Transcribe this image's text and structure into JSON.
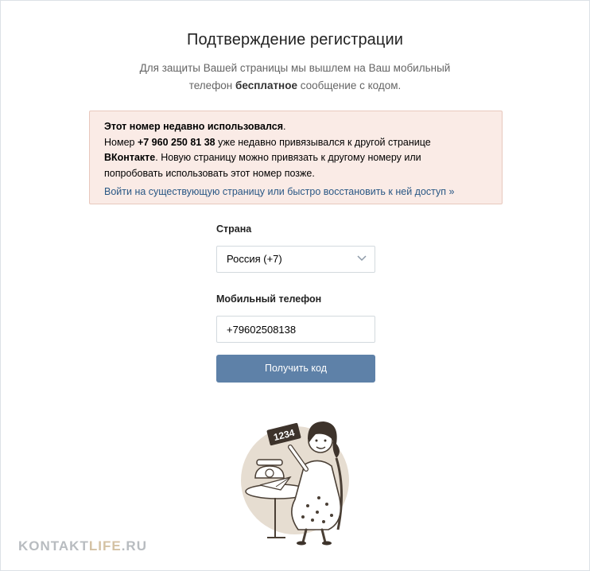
{
  "page": {
    "title": "Подтверждение регистрации",
    "subtitle_line1": "Для защиты Вашей страницы мы вышлем на Ваш мобильный",
    "subtitle_line2_pre": "телефон ",
    "subtitle_line2_bold": "бесплатное",
    "subtitle_line2_post": " сообщение с кодом."
  },
  "alert": {
    "heading": "Этот номер недавно использовался",
    "heading_dot": ".",
    "line1_pre": "Номер ",
    "number": "+7 960 250 81 38",
    "line1_post": " уже недавно привязывался к другой странице",
    "brand": "ВКонтакте",
    "line2_post": ". Новую страницу можно привязать к другому номеру или",
    "line3": "попробовать использовать этот номер позже.",
    "link": "Войти на существующую страницу или быстро восстановить к ней доступ »"
  },
  "form": {
    "country_label": "Страна",
    "country_value": "Россия (+7)",
    "phone_label": "Мобильный телефон",
    "phone_value": "+79602508138",
    "submit_label": "Получить код"
  },
  "illustration": {
    "sign_text": "1234"
  },
  "watermark": {
    "part1": "KONTAKT",
    "part2": "LIFE",
    "part3": ".RU"
  },
  "colors": {
    "accent": "#5e81a8",
    "link": "#2a5885",
    "alert_bg": "#faebe6",
    "alert_border": "#e8c8bd"
  },
  "icons": {
    "country_select": "chevron-down-icon"
  }
}
